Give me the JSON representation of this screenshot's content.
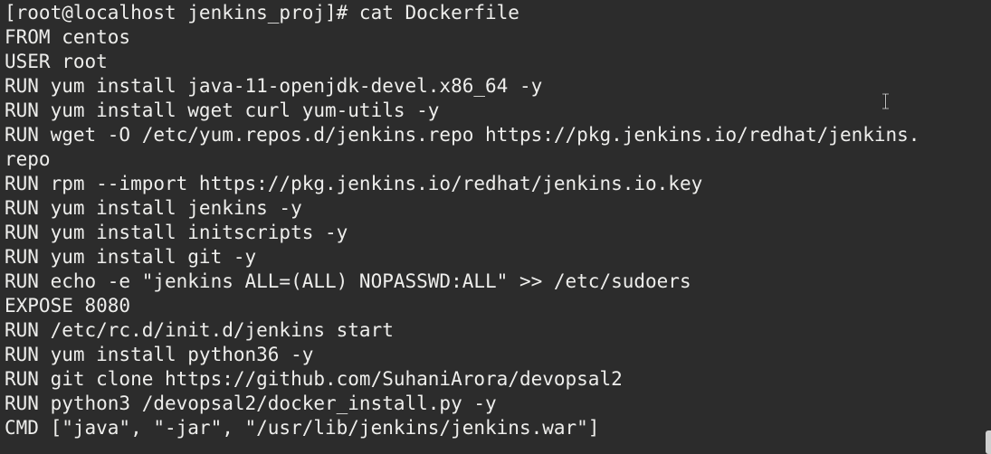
{
  "terminal": {
    "lines": [
      "[root@localhost jenkins_proj]# cat Dockerfile",
      "FROM centos",
      "USER root",
      "RUN yum install java-11-openjdk-devel.x86_64 -y",
      "RUN yum install wget curl yum-utils -y",
      "RUN wget -O /etc/yum.repos.d/jenkins.repo https://pkg.jenkins.io/redhat/jenkins.",
      "repo",
      "RUN rpm --import https://pkg.jenkins.io/redhat/jenkins.io.key",
      "RUN yum install jenkins -y",
      "RUN yum install initscripts -y",
      "RUN yum install git -y",
      "RUN echo -e \"jenkins ALL=(ALL) NOPASSWD:ALL\" >> /etc/sudoers",
      "EXPOSE 8080",
      "RUN /etc/rc.d/init.d/jenkins start",
      "RUN yum install python36 -y",
      "RUN git clone https://github.com/SuhaniArora/devopsal2",
      "RUN python3 /devopsal2/docker_install.py -y",
      "CMD [\"java\", \"-jar\", \"/usr/lib/jenkins/jenkins.war\"]"
    ],
    "mouse_cursor_icon": "text-ibeam-cursor-icon",
    "colors": {
      "background": "#2c2c2c",
      "foreground": "#eeeeec",
      "scrollbar_thumb": "#d0d0d0"
    }
  }
}
